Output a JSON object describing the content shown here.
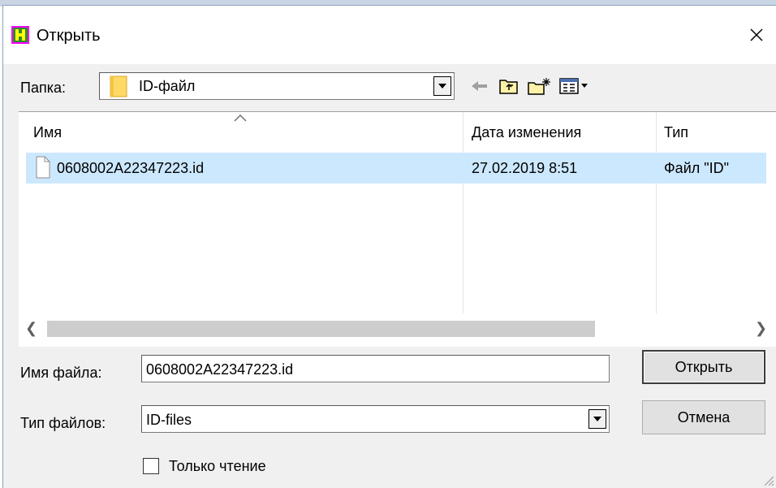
{
  "window": {
    "title": "Открыть",
    "app_icon": "dialog-app-icon",
    "close_glyph": "✕"
  },
  "toolbar": {
    "folder_label": "Папка:",
    "folder_value": "ID-файл",
    "icons": [
      "back-arrow-icon",
      "up-folder-icon",
      "new-folder-icon",
      "view-menu-icon"
    ]
  },
  "file_list": {
    "columns": [
      "Имя",
      "Дата изменения",
      "Тип"
    ],
    "sorted_by": "Имя",
    "rows": [
      {
        "name": "0608002A22347223.id",
        "date": "27.02.2019 8:51",
        "type": "Файл \"ID\"",
        "selected": true
      }
    ]
  },
  "form": {
    "filename_label": "Имя файла:",
    "filename_value": "0608002A22347223.id",
    "filetype_label": "Тип файлов:",
    "filetype_value": "ID-files",
    "readonly_label": "Только чтение",
    "readonly_checked": false
  },
  "buttons": {
    "open": "Открыть",
    "cancel": "Отмена"
  },
  "colors": {
    "selection": "#cce8ff",
    "dialog_bg": "#f0f0f0",
    "app_icon_bg": "#2e8b2e",
    "app_icon_border": "#ff00ff"
  }
}
